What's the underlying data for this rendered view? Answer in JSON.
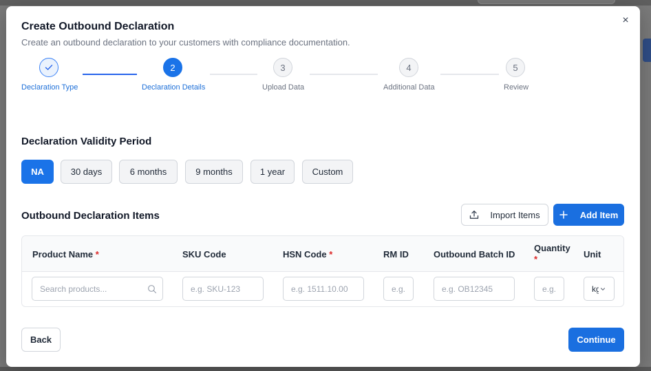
{
  "modal": {
    "title": "Create Outbound Declaration",
    "subtitle": "Create an outbound declaration to your customers with compliance documentation.",
    "close_icon": "×"
  },
  "stepper": {
    "steps": [
      {
        "number": "✓",
        "label": "Declaration Type",
        "state": "done"
      },
      {
        "number": "2",
        "label": "Declaration Details",
        "state": "active"
      },
      {
        "number": "3",
        "label": "Upload Data",
        "state": "todo"
      },
      {
        "number": "4",
        "label": "Additional Data",
        "state": "todo"
      },
      {
        "number": "5",
        "label": "Review",
        "state": "todo"
      }
    ]
  },
  "validity": {
    "title": "Declaration Validity Period",
    "options": [
      "NA",
      "30 days",
      "6 months",
      "9 months",
      "1 year",
      "Custom"
    ],
    "selected": "NA"
  },
  "items": {
    "title": "Outbound Declaration Items",
    "import_label": "Import Items",
    "add_label": "Add Item",
    "columns": [
      {
        "label": "Product Name",
        "required": "*"
      },
      {
        "label": "SKU Code",
        "required": ""
      },
      {
        "label": "HSN Code",
        "required": "*"
      },
      {
        "label": "RM ID",
        "required": ""
      },
      {
        "label": "Outbound Batch ID",
        "required": ""
      },
      {
        "label": "Quantity",
        "required": "*"
      },
      {
        "label": "Unit",
        "required": ""
      }
    ],
    "row": {
      "product_placeholder": "Search products...",
      "sku_placeholder": "e.g. SKU-123",
      "hsn_placeholder": "e.g. 1511.10.00",
      "rm_placeholder": "e.g.",
      "batch_placeholder": "e.g. OB12345",
      "quantity_placeholder": "e.g.",
      "unit_value": "kg"
    }
  },
  "footer": {
    "back_label": "Back",
    "continue_label": "Continue"
  },
  "colors": {
    "primary": "#1a73e8",
    "required": "#dc2626"
  }
}
